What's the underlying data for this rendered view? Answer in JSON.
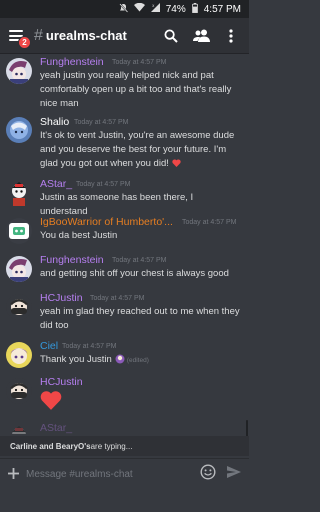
{
  "status": {
    "battery": "74%",
    "time": "4:57 PM"
  },
  "header": {
    "channel_hash": "#",
    "channel_name": "urealms-chat",
    "notification_count": "2"
  },
  "messages": [
    {
      "author": "Funghenstein",
      "timestamp": "Today at 4:57 PM",
      "text": "yeah justin you really helped nick and pat comfortably open up a bit too and that's really nice man",
      "author_color": "#b67ff0"
    },
    {
      "author": "Shalio",
      "timestamp": "Today at 4:57 PM",
      "text": "It's ok to vent Justin, you're an awesome dude and you deserve the best for your future. I'm glad you got out when you did!",
      "reaction_emoji": "heart",
      "author_color": "#ffffff"
    },
    {
      "author": "AStar_",
      "timestamp": "Today at 4:57 PM",
      "text": "Justin as someone has been there, I understand",
      "author_color": "#b67ff0"
    },
    {
      "author": "IgBooWarrior of Humberto'...",
      "timestamp": "Today at 4:57 PM",
      "text": "You da best Justin",
      "author_color": "#e67e22"
    },
    {
      "author": "Funghenstein",
      "timestamp": "Today at 4:57 PM",
      "text": "and getting shit off your chest is always good",
      "author_color": "#b67ff0"
    },
    {
      "author": "HCJustin",
      "timestamp": "Today at 4:57 PM",
      "text": "yeah im glad they reached out to me when they did too",
      "author_color": "#b67ff0"
    },
    {
      "author": "Ciel",
      "timestamp": "Today at 4:57 PM",
      "text": "Thank you Justin",
      "edited": "(edited)",
      "author_color": "#3498db"
    },
    {
      "author": "HCJustin",
      "timestamp": "",
      "text": "",
      "big_emoji": "heart",
      "author_color": "#b67ff0"
    },
    {
      "author": "AStar_",
      "timestamp": "",
      "text": "",
      "author_color": "#b67ff0",
      "faded": true
    }
  ],
  "typing": {
    "users": "Carline and BearyO's",
    "suffix": " are typing..."
  },
  "composer": {
    "placeholder": "Message #urealms-chat"
  },
  "colors": {
    "background": "#36393f",
    "header": "#2f3136",
    "status_bar": "#202225",
    "heart": "#f04747"
  }
}
